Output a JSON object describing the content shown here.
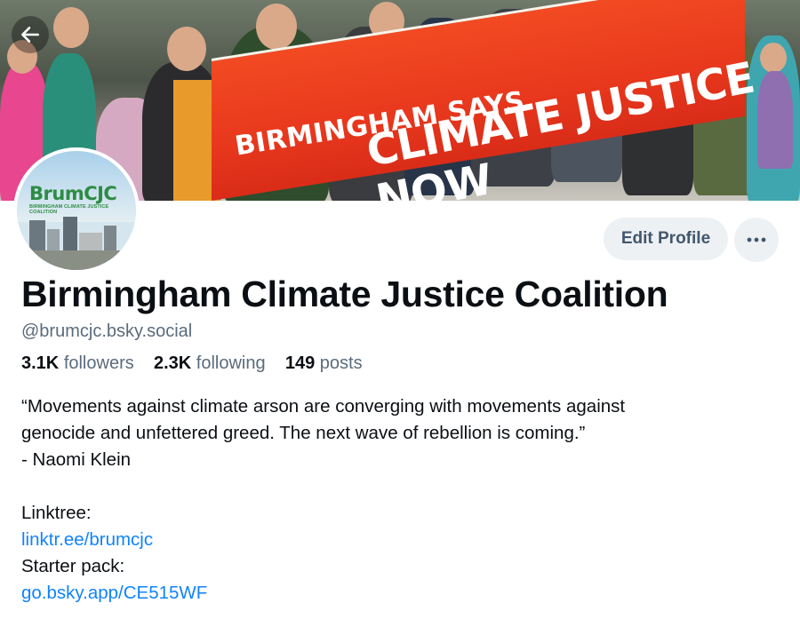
{
  "nav": {
    "back_icon": "arrow-left-icon"
  },
  "banner": {
    "line1": "BIRMINGHAM SAYS",
    "line2": "CLIMATE JUSTICE NOW",
    "partial": "CLIMATE"
  },
  "avatar": {
    "logo_text": "BrumCJC",
    "logo_sub": "BIRMINGHAM CLIMATE JUSTICE COALITION"
  },
  "actions": {
    "edit_label": "Edit Profile",
    "more_icon": "ellipsis-icon"
  },
  "profile": {
    "display_name": "Birmingham Climate Justice Coalition",
    "handle": "@brumcjc.bsky.social",
    "followers_count": "3.1K",
    "followers_label": "followers",
    "following_count": "2.3K",
    "following_label": "following",
    "posts_count": "149",
    "posts_label": "posts"
  },
  "bio": {
    "quote_line1": "“Movements against climate arson are converging with movements against",
    "quote_line2": "genocide and unfettered greed. The next wave of rebellion is coming.”",
    "attribution": "- Naomi Klein",
    "linktree_label": "Linktree:",
    "linktree_url": "linktr.ee/brumcjc",
    "starter_label": "Starter pack:",
    "starter_url": "go.bsky.app/CE515WF"
  },
  "colors": {
    "accent_link": "#1083fe",
    "muted_text": "#5b6b7c",
    "button_bg": "#eef1f4",
    "banner_red": "#e8381d",
    "logo_green": "#2d8c43"
  }
}
